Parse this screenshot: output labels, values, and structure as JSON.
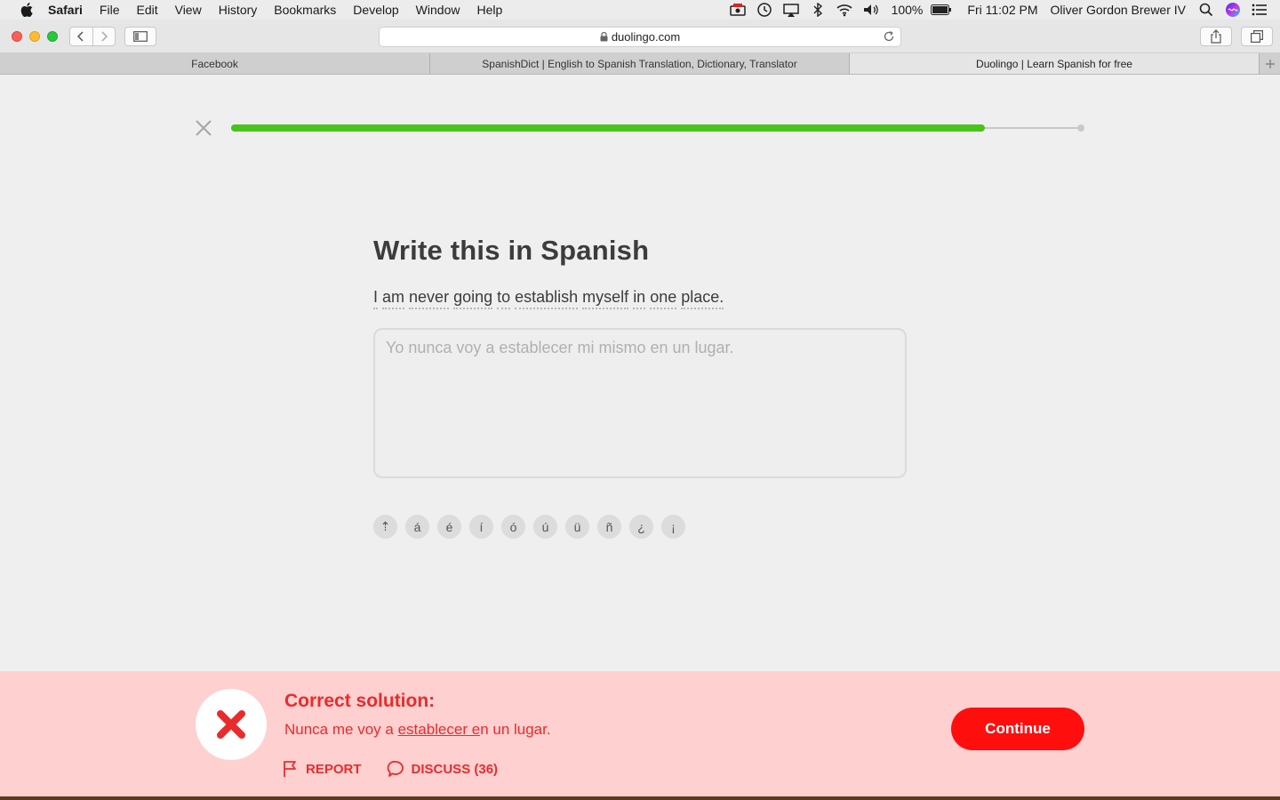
{
  "menubar": {
    "app_name": "Safari",
    "items": [
      "File",
      "Edit",
      "View",
      "History",
      "Bookmarks",
      "Develop",
      "Window",
      "Help"
    ],
    "battery": "100%",
    "clock": "Fri 11:02 PM",
    "user": "Oliver Gordon Brewer IV"
  },
  "toolbar": {
    "url": "duolingo.com"
  },
  "tabs": [
    {
      "title": "Facebook",
      "active": false
    },
    {
      "title": "SpanishDict | English to Spanish Translation, Dictionary, Translator",
      "active": false
    },
    {
      "title": "Duolingo | Learn Spanish for free",
      "active": true
    }
  ],
  "lesson": {
    "progress": 0.887,
    "title": "Write this in Spanish",
    "sentence_words": [
      "I",
      "am",
      "never",
      "going",
      "to",
      "establish",
      "myself",
      "in",
      "one",
      "place."
    ],
    "answer": "Yo nunca voy a establecer mi mismo en un lugar.",
    "accents": [
      "⇡",
      "á",
      "é",
      "í",
      "ó",
      "ú",
      "ü",
      "ñ",
      "¿",
      "¡"
    ]
  },
  "feedback": {
    "title": "Correct solution:",
    "solution_pre": "Nunca me voy a ",
    "solution_underlined": "establecer e",
    "solution_post": "n un lugar.",
    "report_label": "REPORT",
    "discuss_label": "DISCUSS (36)",
    "continue_label": "Continue"
  },
  "colors": {
    "progress": "#49c41b",
    "error": "#ea2b2b",
    "continue_button": "#ff0e0e",
    "feedback_bg": "#ffd0d0"
  }
}
